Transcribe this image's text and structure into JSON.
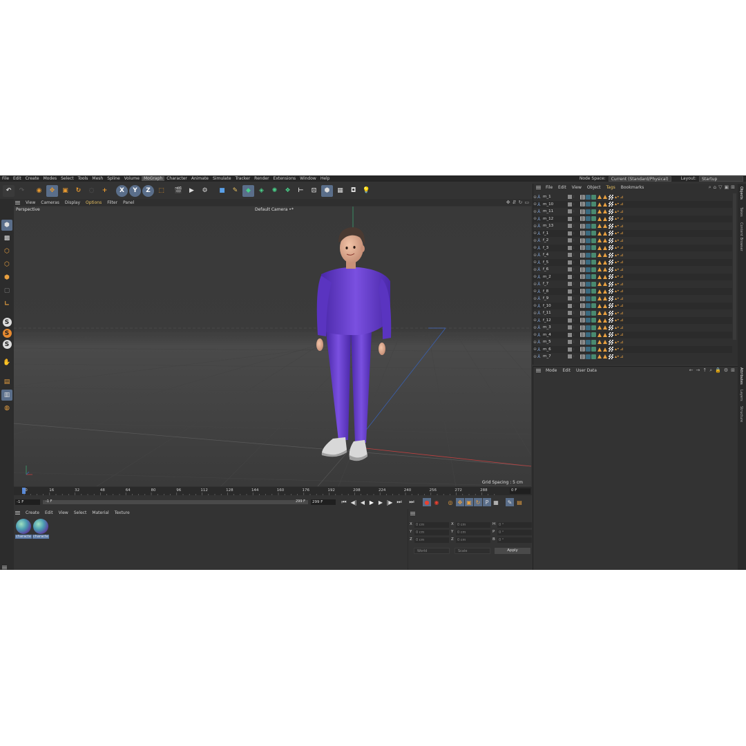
{
  "menubar": {
    "items": [
      "File",
      "Edit",
      "Create",
      "Modes",
      "Select",
      "Tools",
      "Mesh",
      "Spline",
      "Volume",
      "MoGraph",
      "Character",
      "Animate",
      "Simulate",
      "Tracker",
      "Render",
      "Extensions",
      "Window",
      "Help"
    ],
    "active_index": 9,
    "node_space_label": "Node Space:",
    "node_space_value": "Current (Standard/Physical)",
    "layout_label": "Layout:",
    "layout_value": "Startup"
  },
  "viewport": {
    "menu": [
      "View",
      "Cameras",
      "Display",
      "Options",
      "Filter",
      "Panel"
    ],
    "highlight_index": 3,
    "projection": "Perspective",
    "camera": "Default Camera",
    "grid_spacing": "Grid Spacing : 5 cm"
  },
  "timeline": {
    "ticks": [
      "0",
      "16",
      "32",
      "48",
      "64",
      "80",
      "96",
      "112",
      "128",
      "144",
      "160",
      "176",
      "192",
      "208",
      "224",
      "240",
      "256",
      "272",
      "288"
    ],
    "current_frame": "0 F"
  },
  "transport": {
    "start": "-1 F",
    "preview_start": "-1 F",
    "preview_end": "299 F",
    "end": "299 F"
  },
  "materials": {
    "menu": [
      "Create",
      "Edit",
      "View",
      "Select",
      "Material",
      "Texture"
    ],
    "items": [
      {
        "label": "characte"
      },
      {
        "label": "characte"
      }
    ]
  },
  "coordinates": {
    "rows": [
      {
        "a": "X",
        "av": "0 cm",
        "b": "X",
        "bv": "0 cm",
        "c": "H",
        "cv": "0 °"
      },
      {
        "a": "Y",
        "av": "0 cm",
        "b": "Y",
        "bv": "0 cm",
        "c": "P",
        "cv": "0 °"
      },
      {
        "a": "Z",
        "av": "0 cm",
        "b": "Z",
        "bv": "0 cm",
        "c": "B",
        "cv": "0 °"
      }
    ],
    "space": "World",
    "mode": "Scale",
    "apply": "Apply"
  },
  "objects": {
    "menu": [
      "File",
      "Edit",
      "View",
      "Object",
      "Tags",
      "Bookmarks"
    ],
    "highlight_index": 4,
    "rows": [
      "m_1",
      "m_10",
      "m_11",
      "m_12",
      "m_13",
      "f_1",
      "f_2",
      "f_3",
      "f_4",
      "f_5",
      "f_6",
      "m_2",
      "f_7",
      "f_8",
      "f_9",
      "f_10",
      "f_11",
      "f_12",
      "m_3",
      "m_4",
      "m_5",
      "m_6",
      "m_7"
    ]
  },
  "attributes": {
    "menu": [
      "Mode",
      "Edit",
      "User Data"
    ]
  },
  "side_tabs": {
    "top": [
      "Objects",
      "Takes",
      "Content Browser"
    ],
    "bottom": [
      "Attributes",
      "Layers",
      "Structure"
    ]
  },
  "colors": {
    "accent": "#e8c060",
    "selection": "#5a6e8a",
    "viewport_bg": "#3b3b3b",
    "character_suit": "#6a3fd0"
  }
}
